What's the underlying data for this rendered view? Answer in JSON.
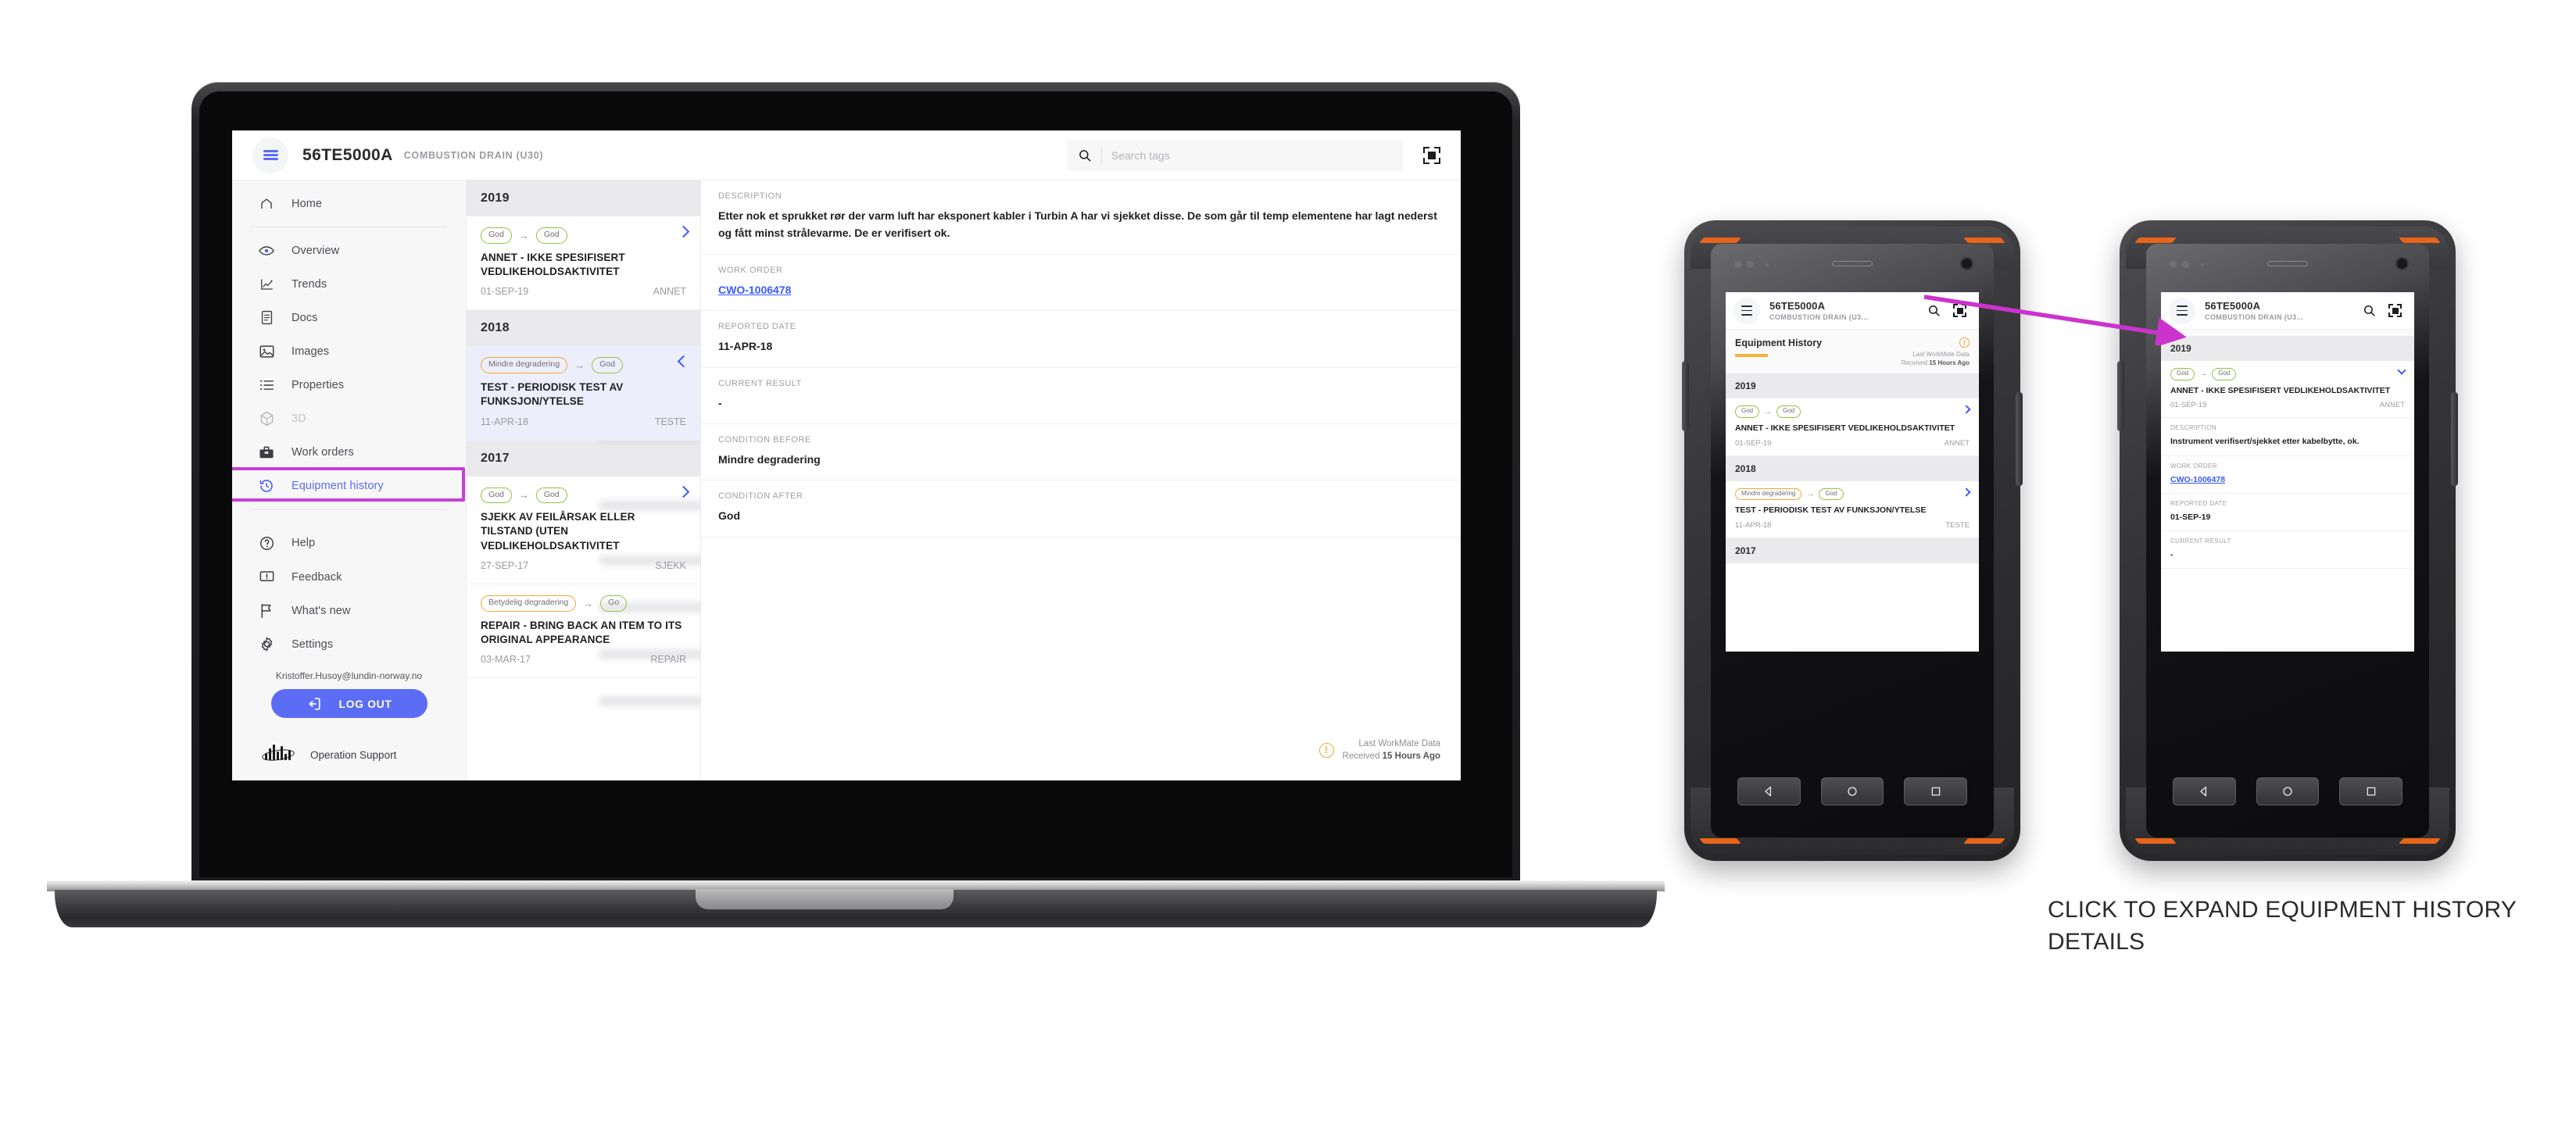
{
  "app": {
    "tag": "56TE5000A",
    "tag_description": "COMBUSTION DRAIN (U30)",
    "tag_description_short": "COMBUSTION DRAIN (U3...",
    "search_placeholder": "Search tags",
    "search_value": ""
  },
  "sidebar": {
    "primary": [
      {
        "label": "Home",
        "icon": "home-icon"
      }
    ],
    "items": [
      {
        "label": "Overview",
        "icon": "eye-icon",
        "state": "normal"
      },
      {
        "label": "Trends",
        "icon": "chart-line-icon",
        "state": "normal"
      },
      {
        "label": "Docs",
        "icon": "document-icon",
        "state": "normal"
      },
      {
        "label": "Images",
        "icon": "image-icon",
        "state": "normal"
      },
      {
        "label": "Properties",
        "icon": "list-icon",
        "state": "normal"
      },
      {
        "label": "3D",
        "icon": "cube-icon",
        "state": "disabled"
      },
      {
        "label": "Work orders",
        "icon": "toolbox-icon",
        "state": "normal"
      },
      {
        "label": "Equipment history",
        "icon": "history-clock-icon",
        "state": "active"
      }
    ],
    "secondary": [
      {
        "label": "Help",
        "icon": "question-circle-icon"
      },
      {
        "label": "Feedback",
        "icon": "feedback-icon"
      },
      {
        "label": "What's new",
        "icon": "flag-icon"
      },
      {
        "label": "Settings",
        "icon": "gear-icon"
      }
    ],
    "user_email": "Kristoffer.Husoy@lundin-norway.no",
    "logout_label": "LOG OUT",
    "logout_icon": "logout-icon",
    "brand_label": "Operation Support"
  },
  "history_list": [
    {
      "year": "2019",
      "entries": [
        {
          "condition_before": "God",
          "condition_before_level": "good",
          "condition_after": "God",
          "condition_after_level": "good",
          "title": "ANNET - IKKE SPESIFISERT VEDLIKEHOLDSAKTIVITET",
          "date": "01-SEP-19",
          "type": "ANNET",
          "chevron": "right",
          "selected": false
        }
      ]
    },
    {
      "year": "2018",
      "entries": [
        {
          "condition_before": "Mindre degradering",
          "condition_before_level": "warn",
          "condition_after": "God",
          "condition_after_level": "good",
          "title": "TEST - PERIODISK TEST AV FUNKSJON/YTELSE",
          "date": "11-APR-18",
          "type": "TESTE",
          "chevron": "left",
          "selected": true
        }
      ]
    },
    {
      "year": "2017",
      "entries": [
        {
          "condition_before": "God",
          "condition_before_level": "good",
          "condition_after": "God",
          "condition_after_level": "good",
          "title": "SJEKK AV FEILÅRSAK ELLER TILSTAND (UTEN VEDLIKEHOLDSAKTIVITET",
          "date": "27-SEP-17",
          "type": "SJEKK",
          "chevron": "right",
          "selected": false
        },
        {
          "condition_before": "Betydelig degradering",
          "condition_before_level": "warn",
          "condition_after": "Go",
          "condition_after_level": "good",
          "title": "REPAIR - BRING BACK AN ITEM TO ITS ORIGINAL APPEARANCE",
          "date": "03-MAR-17",
          "type": "REPAIR",
          "chevron": "none",
          "selected": false
        }
      ]
    }
  ],
  "detail": {
    "fields": [
      {
        "label": "DESCRIPTION",
        "value": "Etter nok et sprukket rør der varm luft har eksponert kabler i Turbin A har vi sjekket disse. De som går til temp elementene har lagt nederst og fått minst strålevarme. De er verifisert ok.",
        "kind": "text"
      },
      {
        "label": "WORK ORDER",
        "value": "CWO-1006478",
        "kind": "link"
      },
      {
        "label": "REPORTED DATE",
        "value": "11-APR-18",
        "kind": "text"
      },
      {
        "label": "CURRENT RESULT",
        "value": "-",
        "kind": "text"
      },
      {
        "label": "CONDITION BEFORE",
        "value": "Mindre degradering",
        "kind": "text"
      },
      {
        "label": "CONDITION AFTER",
        "value": "God",
        "kind": "text"
      }
    ],
    "workmate_line1": "Last WorkMate Data",
    "workmate_line2_prefix": "Received ",
    "workmate_line2_strong": "15 Hours Ago",
    "workmate_icon": "warning-circle-icon"
  },
  "phone_left": {
    "page_title": "Equipment History",
    "workmate_line1": "Last WorkMate Data",
    "workmate_line2_prefix": "Received ",
    "workmate_line2_strong": "15 Hours Ago",
    "groups": [
      {
        "year": "2019",
        "entries": [
          {
            "condition_before": "God",
            "condition_before_level": "good",
            "condition_after": "God",
            "condition_after_level": "good",
            "title": "ANNET - IKKE SPESIFISERT VEDLIKEHOLDSAKTIVITET",
            "date": "01-SEP-19",
            "type": "ANNET",
            "chevron": "right"
          }
        ]
      },
      {
        "year": "2018",
        "entries": [
          {
            "condition_before": "Mindre degradering",
            "condition_before_level": "warn",
            "condition_after": "God",
            "condition_after_level": "good",
            "title": "TEST - PERIODISK TEST AV FUNKSJON/YTELSE",
            "date": "11-APR-18",
            "type": "TESTE",
            "chevron": "right"
          }
        ]
      },
      {
        "year": "2017",
        "entries": []
      }
    ]
  },
  "phone_right": {
    "year": "2019",
    "entry": {
      "condition_before": "God",
      "condition_before_level": "good",
      "condition_after": "God",
      "condition_after_level": "good",
      "title": "ANNET - IKKE SPESIFISERT VEDLIKEHOLDSAKTIVITET",
      "date": "01-SEP-19",
      "type": "ANNET",
      "chevron": "down"
    },
    "fields": [
      {
        "label": "DESCRIPTION",
        "value": "Instrument verifisert/sjekket etter kabelbytte, ok.",
        "kind": "text"
      },
      {
        "label": "WORK ORDER",
        "value": "CWO-1006478",
        "kind": "link"
      },
      {
        "label": "REPORTED DATE",
        "value": "01-SEP-19",
        "kind": "text"
      },
      {
        "label": "CURRENT RESULT",
        "value": "-",
        "kind": "text"
      }
    ]
  },
  "annotation": {
    "caption": "CLICK TO EXPAND EQUIPMENT HISTORY DETAILS",
    "arrow_color": "#cc33cc",
    "highlight_color": "#c43fd6"
  },
  "colors": {
    "accent_blue": "#5b6cf5",
    "link_blue": "#3b5bfd",
    "chip_good": "#8fc43f",
    "chip_warn": "#f0a830",
    "selected_row": "#edeefc"
  }
}
